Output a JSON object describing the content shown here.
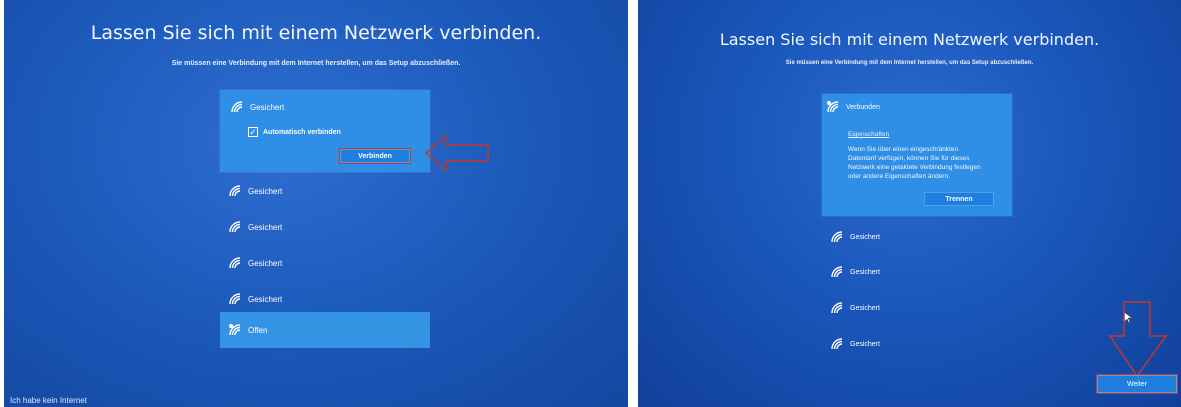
{
  "left": {
    "title": "Lassen Sie sich mit einem Netzwerk verbinden.",
    "subtitle": "Sie müssen eine Verbindung mit dem Internet herstellen, um das Setup abzuschließen.",
    "selected_network": {
      "status": "Gesichert",
      "checkbox_label": "Automatisch verbinden",
      "checkbox_checked": true,
      "connect_button": "Verbinden"
    },
    "networks": [
      {
        "status": "Gesichert",
        "icon": "wifi-icon"
      },
      {
        "status": "Gesichert",
        "icon": "wifi-icon"
      },
      {
        "status": "Gesichert",
        "icon": "wifi-icon"
      },
      {
        "status": "Gesichert",
        "icon": "wifi-icon"
      },
      {
        "status": "Offen",
        "icon": "wifi-open-icon"
      }
    ],
    "no_internet_link": "Ich habe kein Internet"
  },
  "right": {
    "title": "Lassen Sie sich mit einem Netzwerk verbinden.",
    "subtitle": "Sie müssen eine Verbindung mit dem Internet herstellen, um das Setup abzuschließen.",
    "connected_network": {
      "status": "Verbunden",
      "properties_link": "Eigenschaften",
      "info_lines": [
        "Wenn Sie über einen eingeschränkten",
        "Datentarif verfügen, können Sie für dieses",
        "Netzwerk eine getaktete Verbindung festlegen",
        "oder andere Eigenschaften ändern."
      ],
      "disconnect_button": "Trennen"
    },
    "networks": [
      {
        "status": "Gesichert",
        "icon": "wifi-icon"
      },
      {
        "status": "Gesichert",
        "icon": "wifi-icon"
      },
      {
        "status": "Gesichert",
        "icon": "wifi-icon"
      },
      {
        "status": "Gesichert",
        "icon": "wifi-icon"
      }
    ],
    "next_button": "Weiter"
  },
  "colors": {
    "background_blue": "#1d5bbd",
    "selected_item": "#2f8ee6",
    "button_blue": "#1e7fe0",
    "annotation_red": "#c0392b"
  }
}
